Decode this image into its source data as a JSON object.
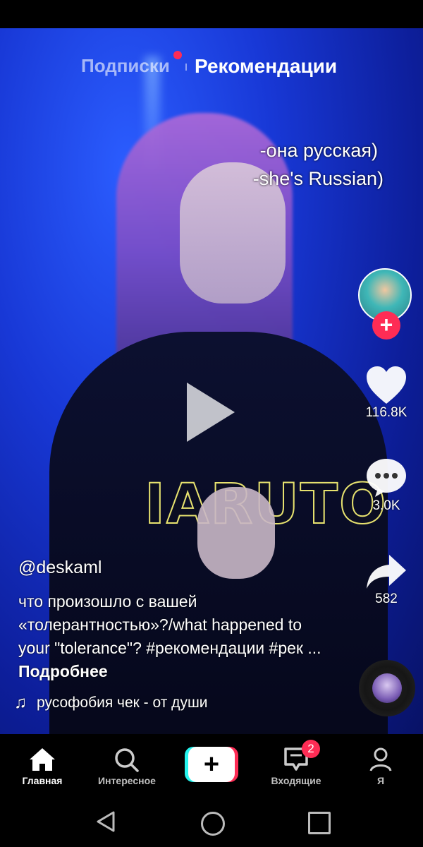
{
  "top_tabs": {
    "following": "Подписки",
    "for_you": "Рекомендации"
  },
  "caption_overlay": {
    "line1": "-она русская)",
    "line2": "-she's Russian)"
  },
  "hoodie_text": "IARUTO",
  "side_actions": {
    "likes": "116.8K",
    "comments": "3.0K",
    "shares": "582"
  },
  "post": {
    "username": "@deskaml",
    "description": "что произошло с вашей «толерантностью»?/what happened to your \"tolerance\"? #рекомендации #рек ...",
    "more": "Подробнее",
    "music": "русофобия чек - от души"
  },
  "bottom_nav": {
    "home": "Главная",
    "discover": "Интересное",
    "create": "+",
    "inbox": "Входящие",
    "inbox_badge": "2",
    "profile": "Я"
  },
  "colors": {
    "accent": "#fe2c55",
    "cyan": "#25f4ee",
    "video_bg": "#1838d6"
  }
}
